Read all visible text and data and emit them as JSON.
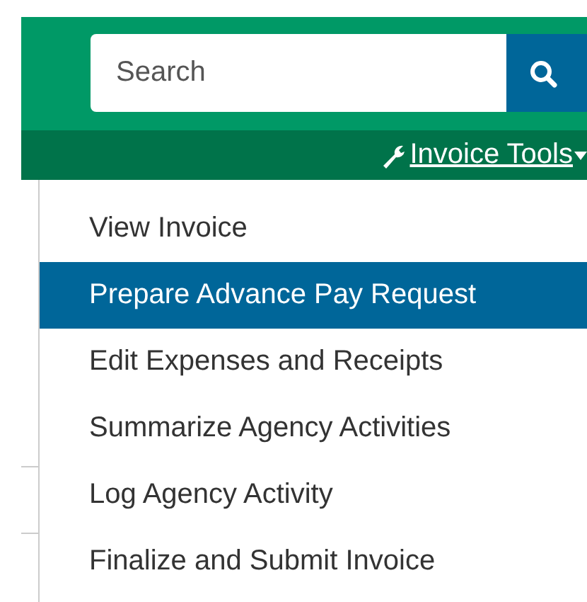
{
  "search": {
    "placeholder": "Search"
  },
  "tools_menu": {
    "label": "Invoice Tools",
    "expanded": true
  },
  "menu_items": [
    {
      "label": "View Invoice",
      "selected": false
    },
    {
      "label": "Prepare Advance Pay Request",
      "selected": true
    },
    {
      "label": "Edit Expenses and Receipts",
      "selected": false
    },
    {
      "label": "Summarize Agency Activities",
      "selected": false
    },
    {
      "label": "Log Agency Activity",
      "selected": false
    },
    {
      "label": "Finalize and Submit Invoice",
      "selected": false
    }
  ]
}
